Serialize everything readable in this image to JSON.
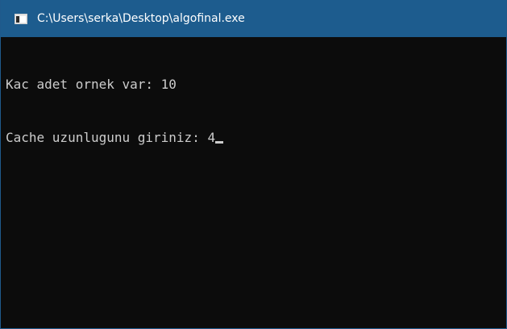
{
  "window": {
    "title": "C:\\Users\\serka\\Desktop\\algofinal.exe",
    "icon": "console-app-icon"
  },
  "console": {
    "lines": [
      "Kac adet ornek var: 10",
      "Cache uzunlugunu giriniz: 4"
    ]
  },
  "colors": {
    "titlebar": "#1d5c8e",
    "background": "#0c0c0c",
    "text": "#cccccc"
  }
}
